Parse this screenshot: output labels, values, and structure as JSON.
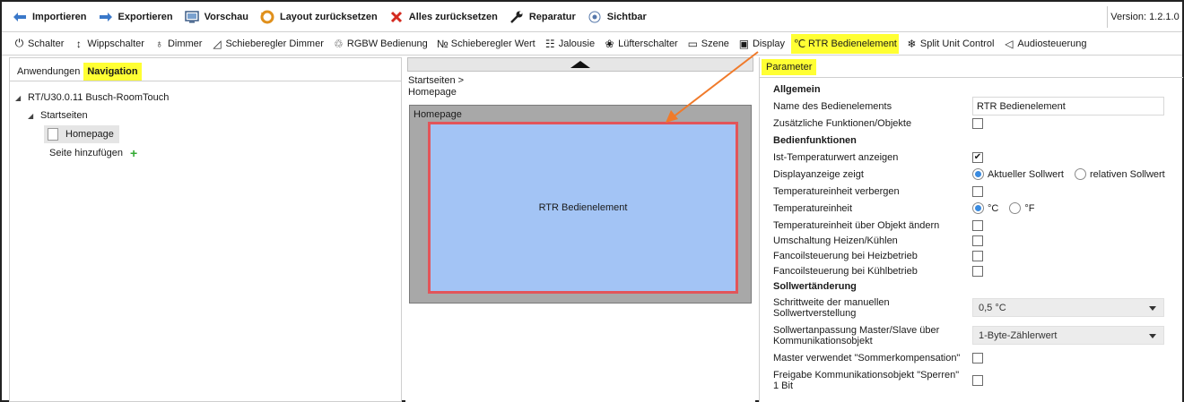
{
  "toolbar": {
    "import_label": "Importieren",
    "export_label": "Exportieren",
    "preview_label": "Vorschau",
    "reset_layout_label": "Layout zurücksetzen",
    "reset_all_label": "Alles zurücksetzen",
    "repair_label": "Reparatur",
    "visible_label": "Sichtbar",
    "version_label": "Version: 1.2.1.0"
  },
  "elements": [
    {
      "label": "Schalter",
      "icon": "power-icon",
      "glyph": "⏻"
    },
    {
      "label": "Wippschalter",
      "icon": "rocker-switch-icon",
      "glyph": "↕"
    },
    {
      "label": "Dimmer",
      "icon": "dimmer-icon",
      "glyph": "♁"
    },
    {
      "label": "Schieberegler Dimmer",
      "icon": "slider-dimmer-icon",
      "glyph": "◿"
    },
    {
      "label": "RGBW Bedienung",
      "icon": "rgbw-bulb-icon",
      "glyph": "♲"
    },
    {
      "label": "Schieberegler Wert",
      "icon": "slider-value-icon",
      "glyph": "№"
    },
    {
      "label": "Jalousie",
      "icon": "blind-icon",
      "glyph": "☷"
    },
    {
      "label": "Lüfterschalter",
      "icon": "fan-icon",
      "glyph": "❀"
    },
    {
      "label": "Szene",
      "icon": "scene-icon",
      "glyph": "▭"
    },
    {
      "label": "Display",
      "icon": "display-icon",
      "glyph": "▣"
    },
    {
      "label": "RTR Bedienelement",
      "icon": "thermometer-icon",
      "glyph": "℃",
      "active": true
    },
    {
      "label": "Split Unit Control",
      "icon": "split-unit-icon",
      "glyph": "❄"
    },
    {
      "label": "Audiosteuerung",
      "icon": "speaker-icon",
      "glyph": "◁"
    }
  ],
  "left": {
    "tab_apps": "Anwendungen",
    "tab_nav": "Navigation",
    "device": "RT/U30.0.11 Busch-RoomTouch",
    "startpages": "Startseiten",
    "homepage": "Homepage",
    "add_page": "Seite hinzufügen"
  },
  "mid": {
    "crumb1": "Startseiten >",
    "crumb2": "Homepage",
    "page_label": "Homepage",
    "widget_label": "RTR Bedienelement"
  },
  "params": {
    "tab": "Parameter",
    "s_general": "Allgemein",
    "name_label": "Name des Bedienelements",
    "name_value": "RTR Bedienelement",
    "extra_label": "Zusätzliche Funktionen/Objekte",
    "s_functions": "Bedienfunktionen",
    "ist_label": "Ist-Temperaturwert anzeigen",
    "display_label": "Displayanzeige zeigt",
    "display_opt1": "Aktueller Sollwert",
    "display_opt2": "relativen Sollwert",
    "hide_unit_label": "Temperatureinheit verbergen",
    "unit_label": "Temperatureinheit",
    "unit_c": "°C",
    "unit_f": "°F",
    "unit_obj_label": "Temperatureinheit über Objekt ändern",
    "heatcool_label": "Umschaltung Heizen/Kühlen",
    "fan_heat_label": "Fancoilsteuerung bei Heizbetrieb",
    "fan_cool_label": "Fancoilsteuerung bei Kühlbetrieb",
    "s_setpoint": "Sollwertänderung",
    "step_label": "Schrittweite der manuellen Sollwertverstellung",
    "step_value": "0,5 °C",
    "master_label": "Sollwertanpassung Master/Slave über Kommunikationsobjekt",
    "master_value": "1-Byte-Zählerwert",
    "summer_label": "Master verwendet \"Sommerkompensation\"",
    "lock_label": "Freigabe Kommunikationsobjekt \"Sperren\" 1 Bit"
  },
  "colors": {
    "highlight": "#ffff33",
    "arrow": "#f07a2a",
    "widget_fill": "#a3c4f5",
    "widget_border": "#e2555a",
    "radio": "#3a8be0"
  }
}
